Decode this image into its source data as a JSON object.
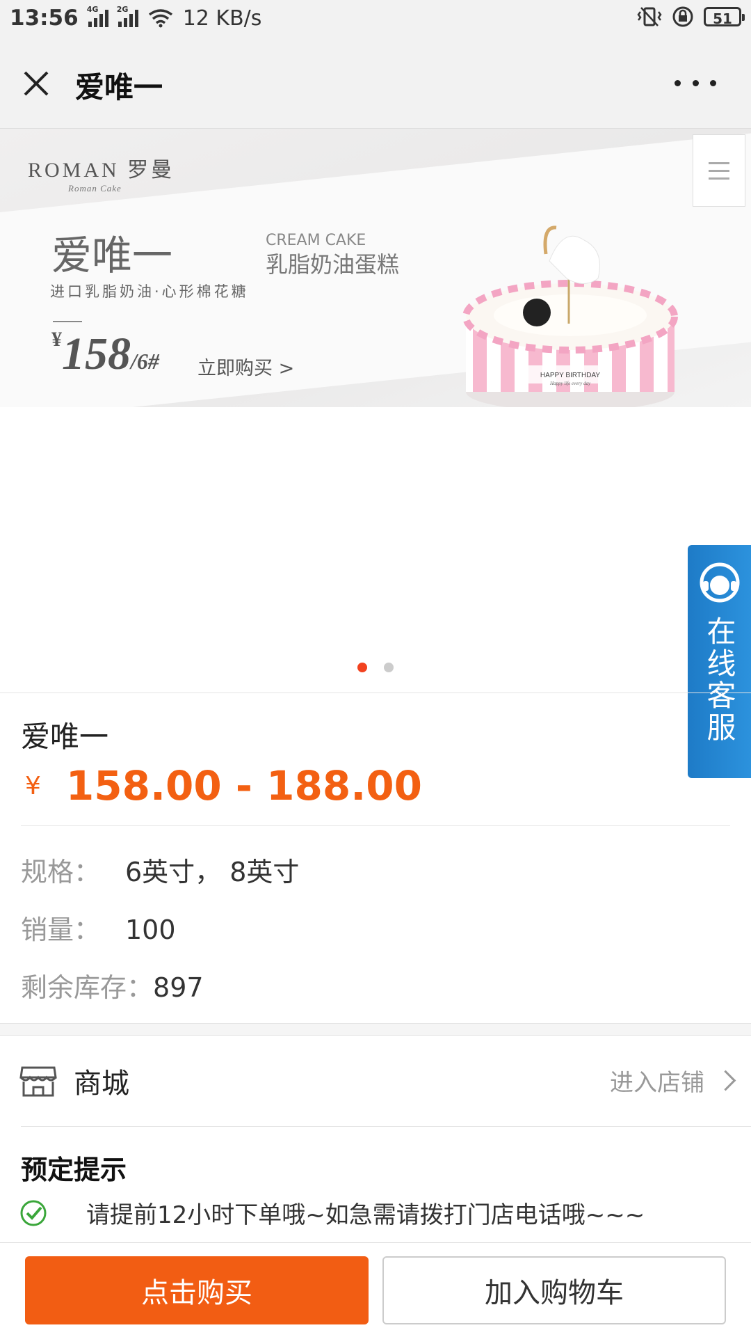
{
  "status": {
    "time": "13:56",
    "net1": "4G",
    "net2": "2G",
    "speed": "12 KB/s",
    "battery": "51"
  },
  "titlebar": {
    "title": "爱唯一",
    "close_icon": "close-icon",
    "more_icon": "more-icon"
  },
  "banner": {
    "brand": "ROMAN 罗曼",
    "brand_sub": "Roman Cake",
    "name": "爱唯一",
    "en": "CREAM CAKE",
    "cn": "乳脂奶油蛋糕",
    "sub": "进口乳脂奶油·心形棉花糖",
    "currency": "¥",
    "price": "158",
    "unit": "/6#",
    "cta": "立即购买 >",
    "cake_plate": "HAPPY BIRTHDAY",
    "cake_plate_sub": "Happy life every day",
    "carousel_index": 1,
    "carousel_count": 2
  },
  "service": {
    "label": "在线客服",
    "icon": "headset-icon",
    "color": "#2488d6"
  },
  "product": {
    "name": "爱唯一",
    "currency": "¥",
    "price_range": "158.00 - 188.00",
    "price_color": "#f36012",
    "attrs": [
      {
        "key": "规格：",
        "value": "6英寸， 8英寸"
      },
      {
        "key": "销量：",
        "value": "100"
      },
      {
        "key": "剩余库存：",
        "value": "897"
      }
    ]
  },
  "shop": {
    "name": "商城",
    "enter_label": "进入店铺",
    "icon": "shop-icon"
  },
  "tips": {
    "title": "预定提示",
    "text": "请提前12小时下单哦~如急需请拨打门店电话哦~~~",
    "icon": "check-circle-icon"
  },
  "actions": {
    "buy_label": "点击购买",
    "cart_label": "加入购物车",
    "buy_color": "#f25d13"
  }
}
